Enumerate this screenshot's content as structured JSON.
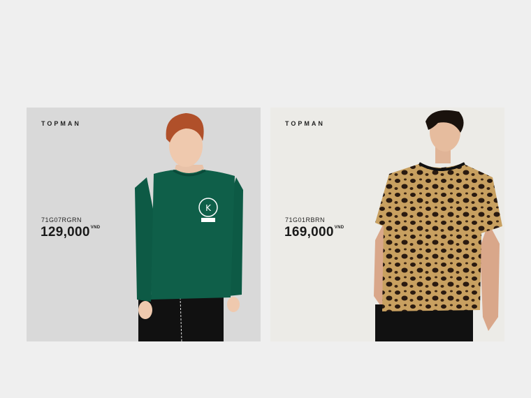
{
  "products": [
    {
      "brand": "TOPMAN",
      "sku": "71G07RGRN",
      "price": "129,000",
      "currency": "VND",
      "shirt_color": "#0d5a45",
      "background": "#d9d9d9"
    },
    {
      "brand": "TOPMAN",
      "sku": "71G01RBRN",
      "price": "169,000",
      "currency": "VND",
      "shirt_pattern": "leopard",
      "background": "#ecebe7"
    }
  ]
}
